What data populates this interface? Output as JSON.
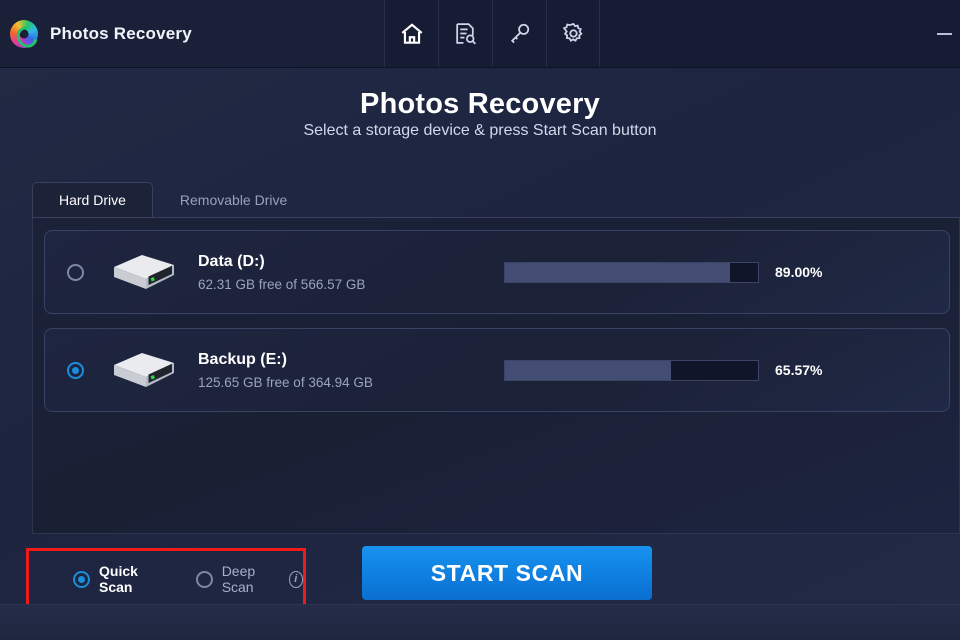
{
  "window": {
    "app_name": "Photos Recovery",
    "logo_icon": "photos-recovery-logo",
    "minimize_label": "",
    "toolbar": [
      {
        "name": "home-icon",
        "label": "Home",
        "active": true
      },
      {
        "name": "document-search-icon",
        "label": "Scan Log",
        "active": false
      },
      {
        "name": "key-icon",
        "label": "Register",
        "active": false
      },
      {
        "name": "gear-icon",
        "label": "Settings",
        "active": false
      }
    ]
  },
  "header": {
    "title": "Photos Recovery",
    "subtitle": "Select a storage device & press Start Scan button"
  },
  "tabs": [
    {
      "label": "Hard Drive",
      "active": true
    },
    {
      "label": "Removable Drive",
      "active": false
    }
  ],
  "drives": [
    {
      "name": "Data (D:)",
      "capacity_text": "62.31 GB free of 566.57 GB",
      "used_percent": 89.0,
      "percent_text": "89.00%",
      "selected": false,
      "icon": "hard-drive-icon"
    },
    {
      "name": "Backup (E:)",
      "capacity_text": "125.65 GB free of 364.94 GB",
      "used_percent": 65.57,
      "percent_text": "65.57%",
      "selected": true,
      "icon": "hard-drive-icon"
    }
  ],
  "scan_options": {
    "quick": {
      "label": "Quick Scan",
      "selected": true
    },
    "deep": {
      "label": "Deep Scan",
      "selected": false
    },
    "info_icon": "info-icon",
    "highlight_color": "#ef1b1b"
  },
  "start_button": {
    "label": "START SCAN",
    "color": "#0f7fe0"
  }
}
